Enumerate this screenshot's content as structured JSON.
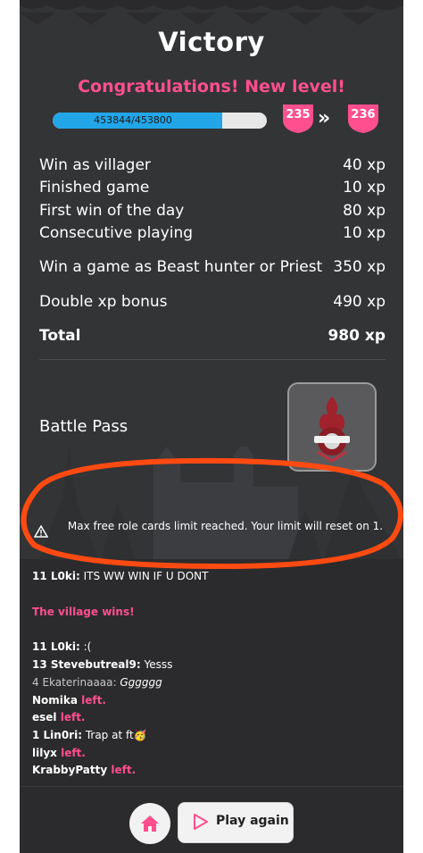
{
  "colors": {
    "accent": "#ff4f8e",
    "progress": "#22a6e8",
    "panel": "#333436"
  },
  "header": {
    "title": "Victory",
    "subtitle": "Congratulations!  New level!"
  },
  "level": {
    "progress_text": "453844/453800",
    "progress_fraction": 0.79,
    "from": "235",
    "to": "236"
  },
  "xp_rows": [
    {
      "label": "Win as villager",
      "xp": "40 xp"
    },
    {
      "label": "Finished game",
      "xp": "10 xp"
    },
    {
      "label": "First win of the day",
      "xp": "80 xp"
    },
    {
      "label": "Consecutive playing",
      "xp": "10 xp"
    },
    {
      "label": "Win a game as Beast hunter or Priest",
      "xp": "350 xp"
    },
    {
      "label": "Double xp bonus",
      "xp": "490 xp"
    },
    {
      "label": "Total",
      "xp": "980 xp"
    }
  ],
  "battle_pass": {
    "label": "Battle Pass",
    "icon": "battle-pass-emblem-icon"
  },
  "notice": {
    "text": "Max free role cards limit reached. Your limit will reset on 1.",
    "icon": "warning-icon"
  },
  "chat": {
    "m1": {
      "user": "11 L0ki:",
      "text": " ITS WW WIN IF U DONT"
    },
    "m2": {
      "text": "The village wins!"
    },
    "m3": {
      "user": "11 L0ki:",
      "text": " :("
    },
    "m4": {
      "user": "13 Stevebutreal9:",
      "text": " Yesss"
    },
    "m5": {
      "user": "4 Ekaterinaaaa:",
      "text": " Gggggg"
    },
    "m6": {
      "user": "Nomika",
      "text": " left."
    },
    "m7": {
      "user": "esel",
      "text": " left."
    },
    "m8": {
      "user": "1 Lin0ri:",
      "text": " Trap at ft🥳"
    },
    "m9": {
      "user": "lilyx",
      "text": " left."
    },
    "m10": {
      "user": "KrabbyPatty",
      "text": " left."
    }
  },
  "bottom": {
    "home_icon": "home-icon",
    "play_again_label": "Play again",
    "play_icon": "play-icon"
  }
}
